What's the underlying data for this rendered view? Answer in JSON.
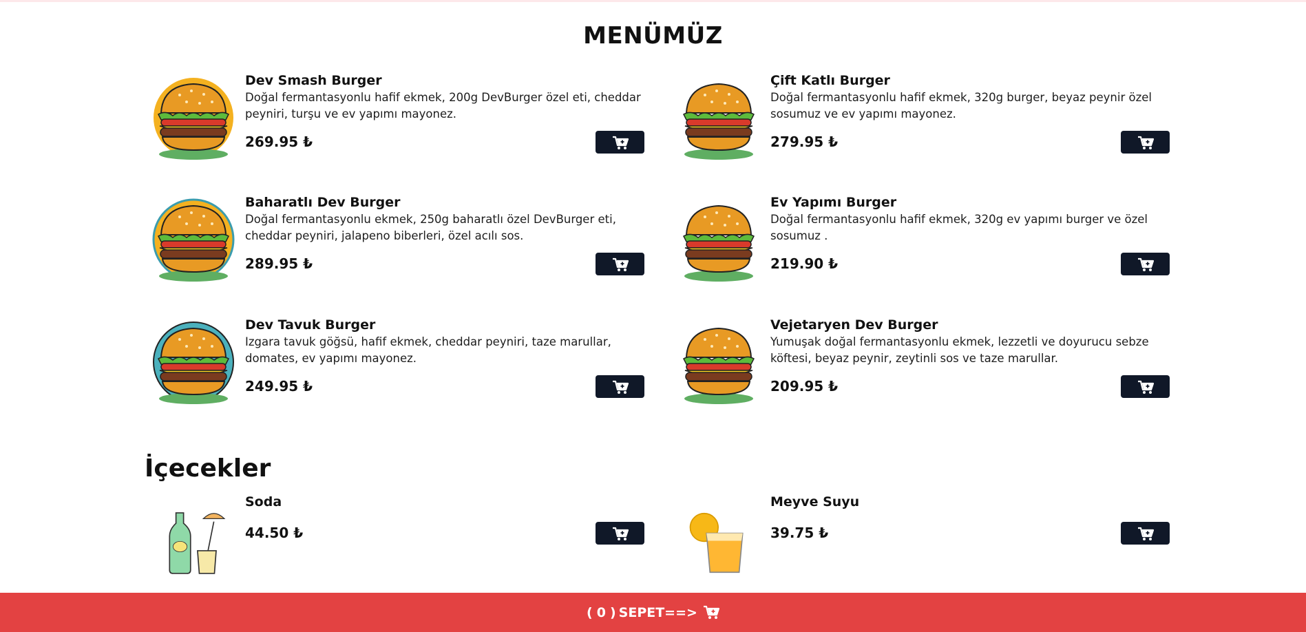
{
  "menu": {
    "title": "MENÜMÜZ"
  },
  "burgers": [
    {
      "name": "Dev Smash Burger",
      "desc": "Doğal fermantasyonlu hafif ekmek, 200g DevBurger özel eti, cheddar peyniri, turşu ve ev yapımı mayonez.",
      "price": "269.95 ₺"
    },
    {
      "name": "Çift Katlı Burger",
      "desc": "Doğal fermantasyonlu hafif ekmek, 320g burger, beyaz peynir özel sosumuz ve ev yapımı mayonez.",
      "price": "279.95 ₺"
    },
    {
      "name": "Baharatlı Dev Burger",
      "desc": "Doğal fermantasyonlu ekmek, 250g baharatlı özel DevBurger eti, cheddar peyniri, jalapeno biberleri, özel acılı sos.",
      "price": "289.95 ₺"
    },
    {
      "name": "Ev Yapımı Burger",
      "desc": "Doğal fermantasyonlu hafif ekmek, 320g ev yapımı burger ve özel sosumuz .",
      "price": "219.90 ₺"
    },
    {
      "name": "Dev Tavuk Burger",
      "desc": "Izgara tavuk göğsü, hafif ekmek, cheddar peyniri, taze marullar, domates, ev yapımı mayonez.",
      "price": "249.95 ₺"
    },
    {
      "name": "Vejetaryen Dev Burger",
      "desc": "Yumuşak doğal fermantasyonlu ekmek, lezzetli ve doyurucu sebze köftesi, beyaz peynir, zeytinli sos ve taze marullar.",
      "price": "209.95 ₺"
    }
  ],
  "drinks_section": {
    "title": "İçecekler"
  },
  "drinks": [
    {
      "name": "Soda",
      "price": "44.50 ₺"
    },
    {
      "name": "Meyve Suyu",
      "price": "39.75 ₺"
    }
  ],
  "cart": {
    "open": "(",
    "count": "0",
    "close": ")",
    "label": "SEPET==>"
  },
  "colors": {
    "button": "#101828",
    "footer": "#e34242"
  }
}
